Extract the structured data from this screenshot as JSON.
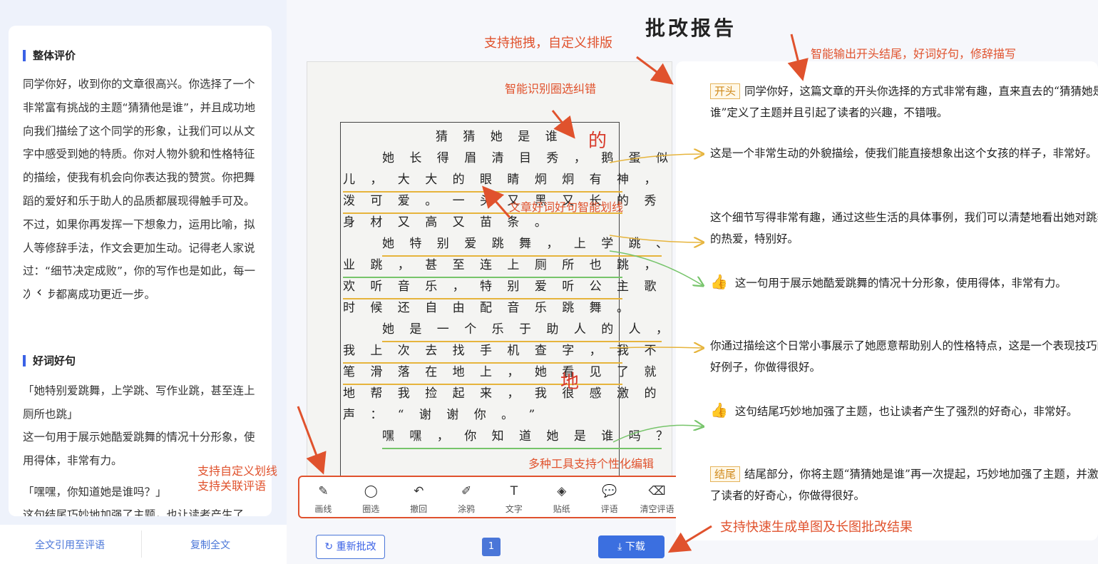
{
  "left": {
    "overall_title": "整体评价",
    "overall_text": "同学你好，收到你的文章很高兴。你选择了一个非常富有挑战的主题“猜猜他是谁”，并且成功地向我们描绘了这个同学的形象，让我们可以从文字中感受到她的特质。你对人物外貌和性格特征的描绘，使我有机会向你表达我的赞赏。你把舞蹈的爱好和乐于助人的品质都展现得触手可及。不过，如果你再发挥一下想象力，运用比喻，拟人等修辞手法，作文会更加生动。记得老人家说过：“细节决定成败”，你的写作也是如此，每一次进步都离成功更近一步。",
    "phrases_title": "好词好句",
    "quote1": "「她特别爱跳舞，上学跳、写作业跳，甚至连上厕所也跳」",
    "comment1": "这一句用于展示她酷爱跳舞的情况十分形象，使用得体，非常有力。",
    "quote2": "「嘿嘿，你知道她是谁吗？」",
    "comment2": "这句结尾巧妙地加强了主题，也让读者产生了",
    "back_arrow": "‹",
    "footer": {
      "cite_all": "全文引用至评语",
      "copy_all": "复制全文"
    }
  },
  "center": {
    "report_title": "批改报告",
    "paper_lines": [
      "猜 猜 她 是 谁",
      "她 长 得 眉 清 目 秀 ， 鹅 蛋 似 得 脸",
      "儿 ， 大 大 的 眼 睛 炯 炯 有 神 ， 机 灵 活",
      "泼 可 爱 。 一 头 又 黑 又 长 的 秀 发 ， 她",
      "身 材 又 高 又 苗 条 。",
      "她 特 别 爱 跳 舞 ， 上 学 跳 、 写 作",
      "业 跳 ， 甚 至 连 上 厕 所 也 跳 ， 她 也 喜",
      "欢 听 音 乐 ， 特 别 爱 听 公 主 歌 曲 ， 有",
      "时 候 还 自 由 配 音 乐 跳 舞 。",
      "她 是 一 个 乐 于 助 人 的 人 ， 记 得",
      "我 上 次 去 找 手 机 查 字 ， 我 不 小 心 把",
      "笔 滑 落 在 地 上 ， 她 看 见 了 就 很 开 心",
      "地 帮 我 捡 起 来 ， 我 很 感 激 的 说 了 一",
      "声 ： “ 谢 谢 你 。 ”",
      "嘿 嘿 ， 你 知 道 她 是 谁 吗 ？"
    ],
    "correction1": "的",
    "correction2": "地",
    "tools": [
      {
        "icon": "pen-icon",
        "glyph": "✎",
        "label": "画线"
      },
      {
        "icon": "lasso-icon",
        "glyph": "◯",
        "label": "圈选"
      },
      {
        "icon": "undo-icon",
        "glyph": "↶",
        "label": "撤回"
      },
      {
        "icon": "brush-icon",
        "glyph": "✐",
        "label": "涂鸦"
      },
      {
        "icon": "text-icon",
        "glyph": "T",
        "label": "文字"
      },
      {
        "icon": "sticker-icon",
        "glyph": "◈",
        "label": "贴纸"
      },
      {
        "icon": "comment-icon",
        "glyph": "💬",
        "label": "评语"
      },
      {
        "icon": "clear-icon",
        "glyph": "⌫",
        "label": "清空评语"
      }
    ],
    "rebatch": "重新批改",
    "rebatch_icon": "↻",
    "page": "1",
    "download": "下载",
    "download_icon": "⤓"
  },
  "right": {
    "tag_open": "开头",
    "tag_end": "结尾",
    "thumb_icon": "👍",
    "item1": "同学你好，这篇文章的开头你选择的方式非常有趣，直来直去的“猜猜她是谁”定义了主题并且引起了读者的兴趣，不错哦。",
    "item2": "这是一个非常生动的外貌描绘，使我们能直接想象出这个女孩的样子，非常好。",
    "item3": "这个细节写得非常有趣，通过这些生活的具体事例，我们可以清楚地看出她对跳舞的热爱，特别好。",
    "item4": "这一句用于展示她酷爱跳舞的情况十分形象，使用得体，非常有力。",
    "item5": "你通过描绘这个日常小事展示了她愿意帮助别人的性格特点，这是一个表现技巧的好例子，你做得很好。",
    "item6": "这句结尾巧妙地加强了主题，也让读者产生了强烈的好奇心，非常好。",
    "item7": "结尾部分，你将主题“猜猜她是谁”再一次提起，巧妙地加强了主题，并激发了读者的好奇心，你做得很好。"
  },
  "annotations": {
    "drag": "支持拖拽，自定义排版",
    "smart_output": "智能输出开头结尾，好词好句，修辞描写",
    "circle": "智能识别圈选纠错",
    "underline": "文章好词好句智能划线",
    "tools": "多种工具支持个性化编辑",
    "custom_line1": "支持自定义划线",
    "custom_line2": "支持关联评语",
    "quick": "支持快速生成单图及长图批改结果"
  }
}
